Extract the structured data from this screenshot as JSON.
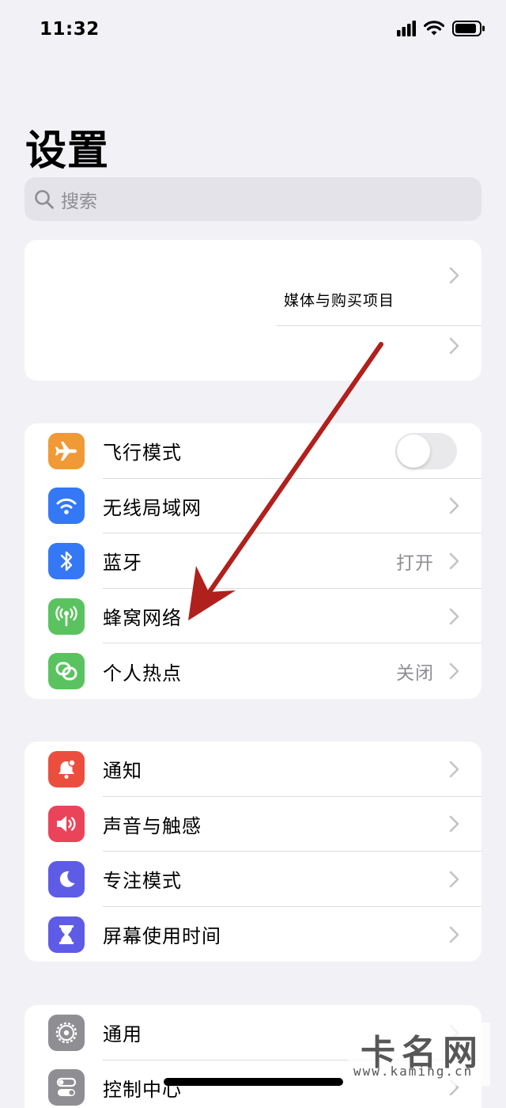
{
  "status_bar": {
    "time": "11:32"
  },
  "page": {
    "title": "设置"
  },
  "search": {
    "placeholder": "搜索"
  },
  "account_group": {
    "row1_label": "媒体与购买项目"
  },
  "connectivity_group": {
    "items": [
      {
        "label": "飞行模式",
        "icon": "airplane-icon",
        "color": "#f09a37",
        "control": "toggle",
        "toggle_on": false
      },
      {
        "label": "无线局域网",
        "icon": "wifi-icon",
        "color": "#3478f6",
        "control": "chevron"
      },
      {
        "label": "蓝牙",
        "icon": "bluetooth-icon",
        "color": "#3478f6",
        "value": "打开",
        "control": "chevron"
      },
      {
        "label": "蜂窝网络",
        "icon": "cellular-antenna-icon",
        "color": "#5ac360",
        "control": "chevron"
      },
      {
        "label": "个人热点",
        "icon": "hotspot-link-icon",
        "color": "#5ac360",
        "value": "关闭",
        "control": "chevron"
      }
    ]
  },
  "notification_group": {
    "items": [
      {
        "label": "通知",
        "icon": "notification-bell-icon",
        "color": "#eb4e3d"
      },
      {
        "label": "声音与触感",
        "icon": "speaker-icon",
        "color": "#eb445a"
      },
      {
        "label": "专注模式",
        "icon": "moon-icon",
        "color": "#5e5ce6"
      },
      {
        "label": "屏幕使用时间",
        "icon": "hourglass-icon",
        "color": "#5e5ce6"
      }
    ]
  },
  "general_group": {
    "items": [
      {
        "label": "通用",
        "icon": "gear-icon",
        "color": "#8e8e93"
      },
      {
        "label": "控制中心",
        "icon": "toggles-icon",
        "color": "#8e8e93"
      }
    ]
  },
  "annotation": {
    "arrow_color": "#b0201c"
  },
  "watermark": {
    "main": "卡名网",
    "sub": "www.kaming.cn"
  }
}
